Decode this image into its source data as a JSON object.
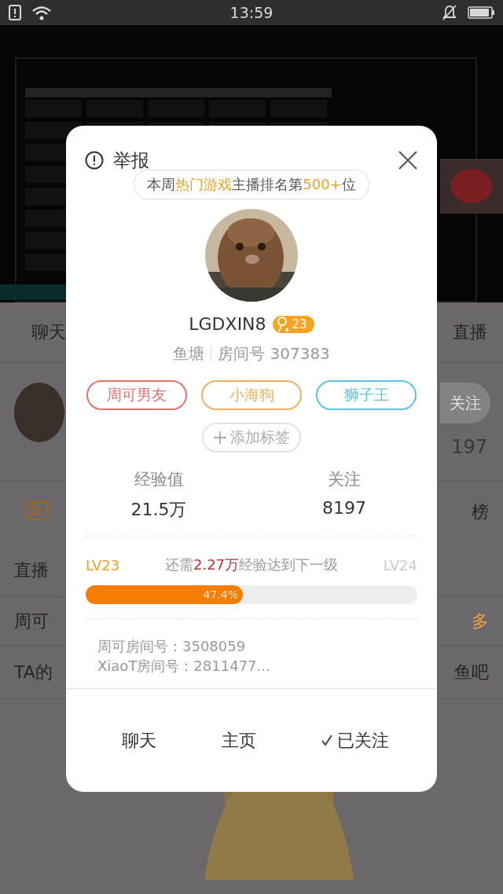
{
  "status_bar": {
    "time": "13:59"
  },
  "background": {
    "tabs": [
      {
        "label": "聊天"
      },
      {
        "label": "直播"
      }
    ],
    "follow_button": "关注",
    "follow_count": "197",
    "rows": [
      {
        "left": "",
        "right": "榜",
        "kind": "video"
      },
      {
        "left": "直播",
        "right": "",
        "kind": "title"
      },
      {
        "left": "周可",
        "right": "多",
        "kind": "notice"
      },
      {
        "left": "TA的",
        "right": "鱼吧",
        "kind": "title"
      }
    ]
  },
  "modal": {
    "report": "举报",
    "rank": [
      {
        "text": "本周",
        "highlight": false
      },
      {
        "text": "热门游戏",
        "highlight": true
      },
      {
        "text": "主播排名第",
        "highlight": false
      },
      {
        "text": "500+",
        "highlight": true
      },
      {
        "text": "位",
        "highlight": false
      }
    ],
    "name": "LGDXIN8",
    "level_badge": "23",
    "group": "鱼塘",
    "room": "房间号 307383",
    "tags": [
      {
        "label": "周可男友",
        "color": "#e5706f"
      },
      {
        "label": "小海狗",
        "color": "#f0b060"
      },
      {
        "label": "狮子王",
        "color": "#5ec3e0"
      }
    ],
    "add_tag": "添加标签",
    "stats": [
      {
        "label": "经验值",
        "value": "21.5万"
      },
      {
        "label": "关注",
        "value": "8197"
      }
    ],
    "level_current": "LV23",
    "level_next": "LV24",
    "level_hint": [
      {
        "text": "还需",
        "highlight": false
      },
      {
        "text": "2.27万",
        "highlight": true
      },
      {
        "text": "经验达到下一级",
        "highlight": false
      }
    ],
    "progress": {
      "level": 0.474,
      "label": "47.4%"
    },
    "notes": [
      "周可房间号：3508059",
      "XiaoT房间号：2811477..."
    ],
    "actions": [
      {
        "label": "聊天",
        "followed": false
      },
      {
        "label": "主页",
        "followed": false
      },
      {
        "label": "已关注",
        "followed": true
      }
    ]
  }
}
